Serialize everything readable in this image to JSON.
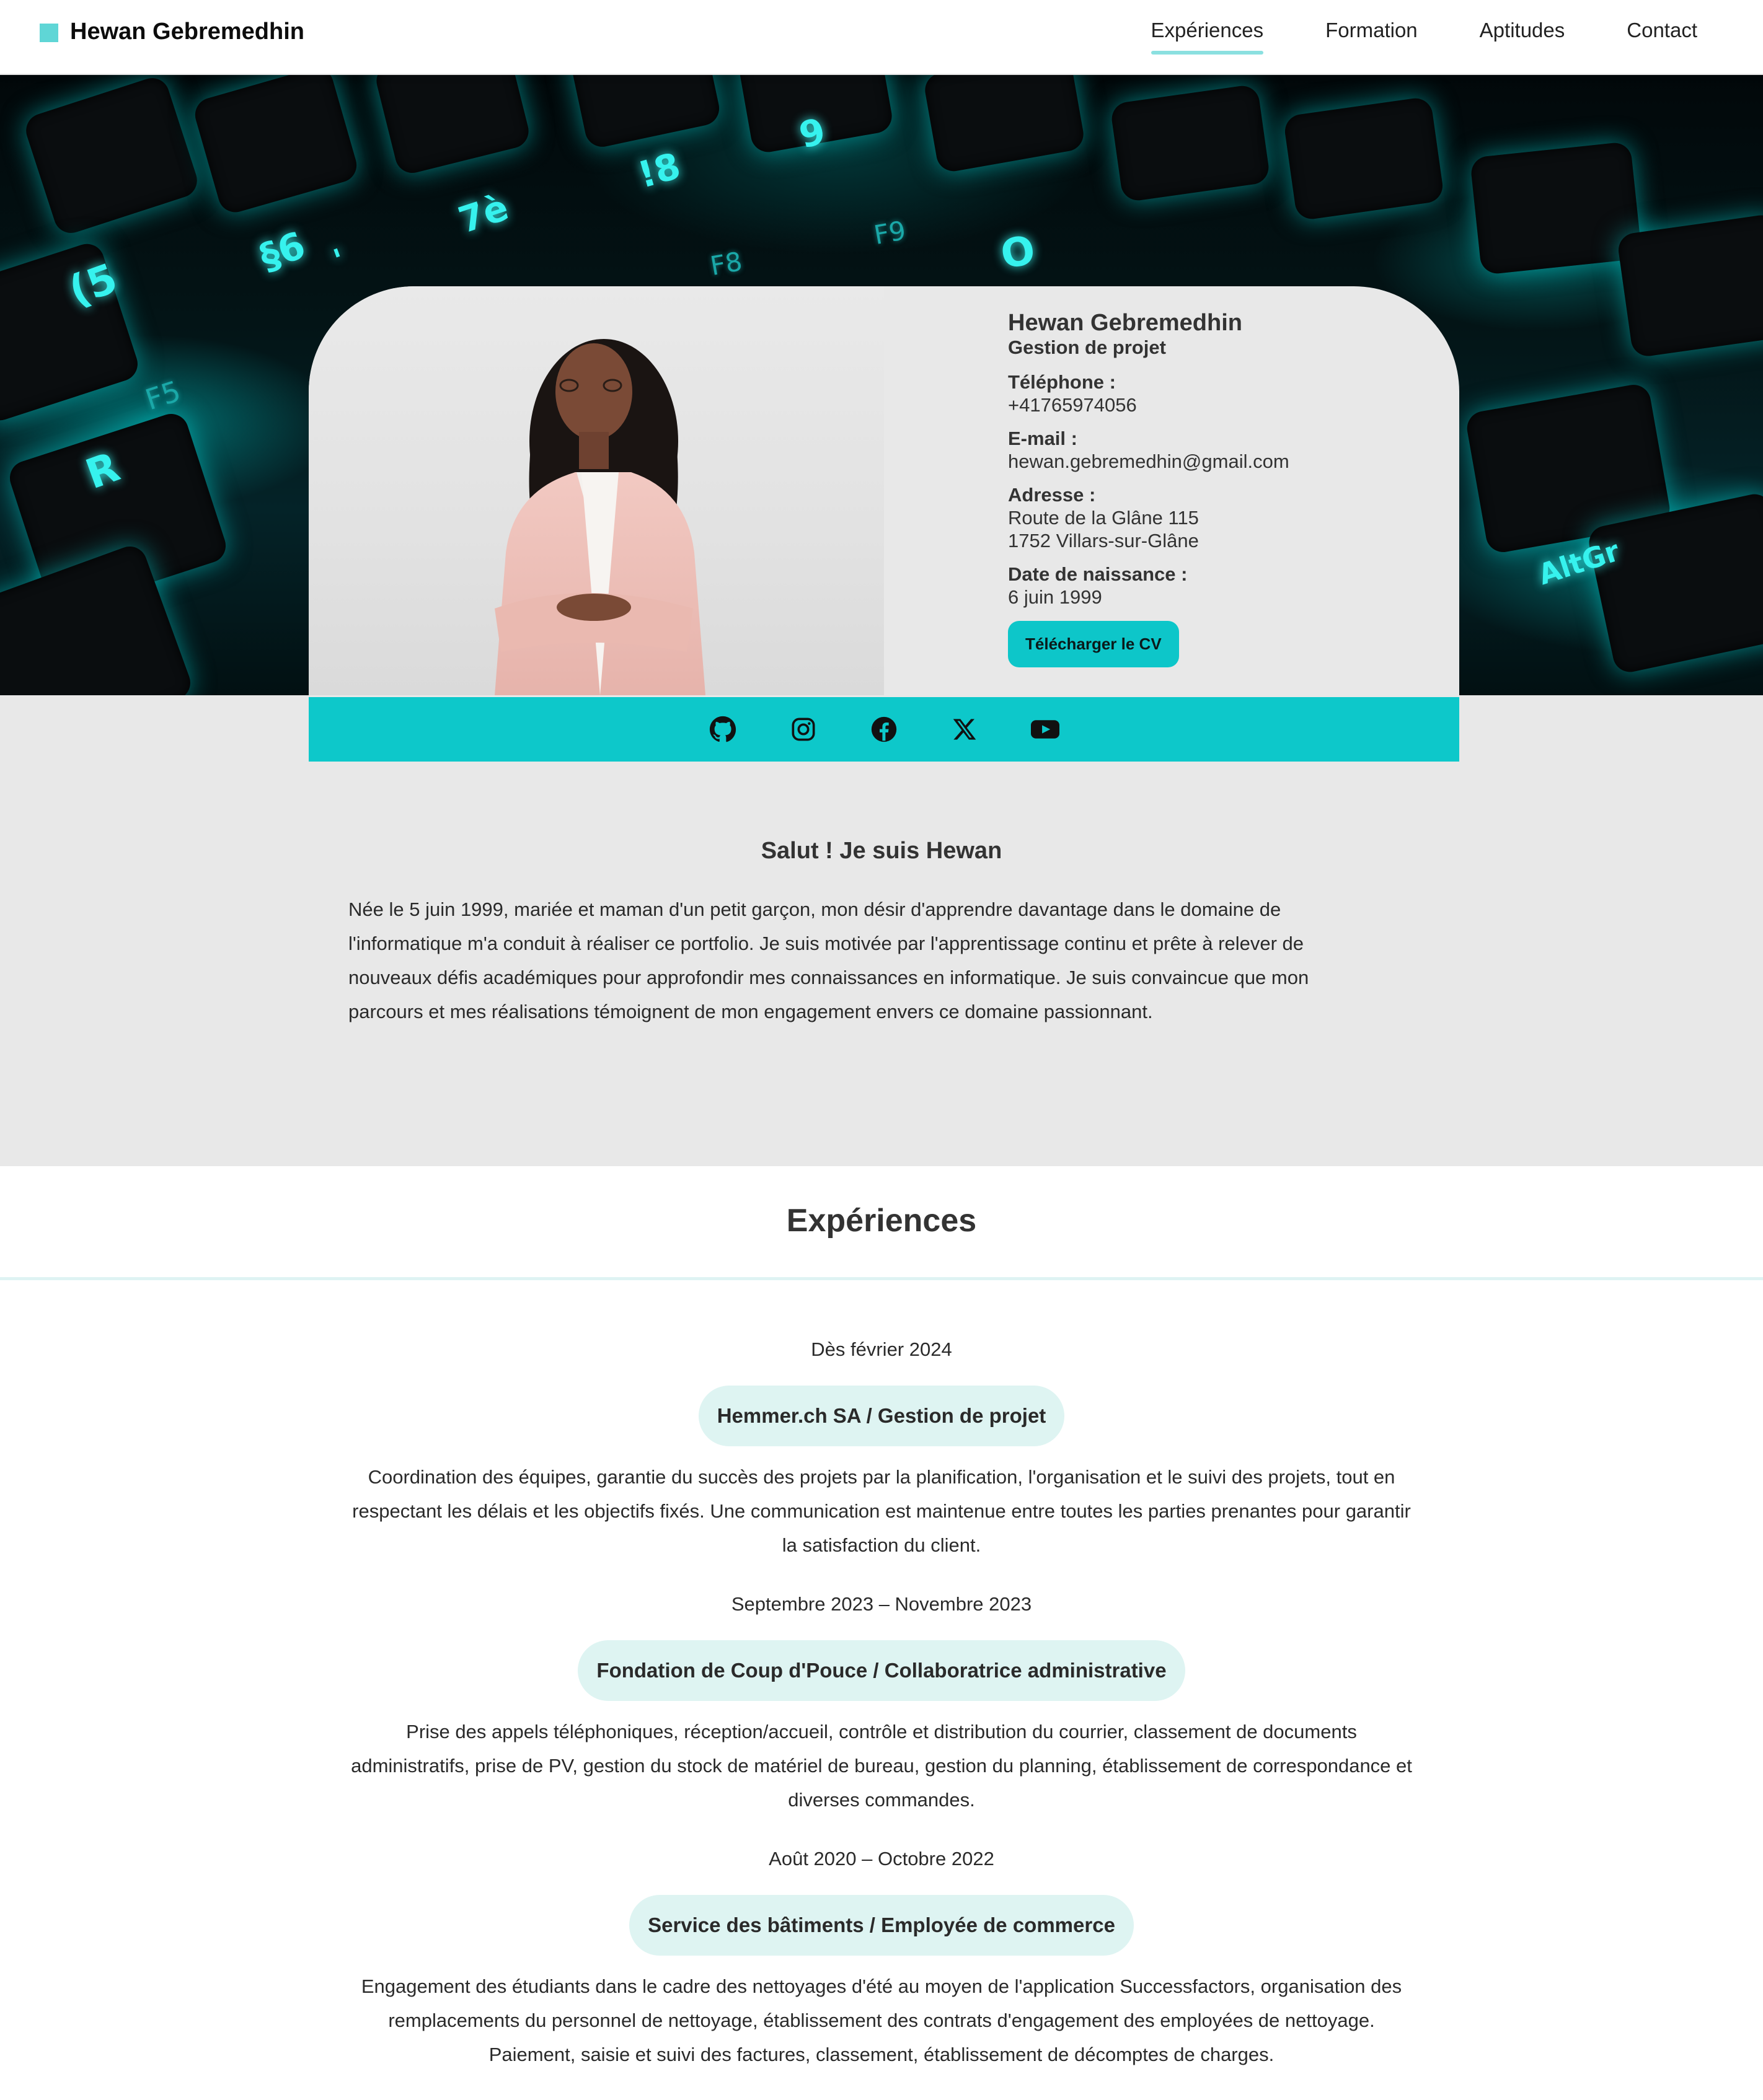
{
  "header": {
    "brand": "Hewan Gebremedhin",
    "nav": [
      "Expériences",
      "Formation",
      "Aptitudes",
      "Contact"
    ],
    "active_nav": "Expériences"
  },
  "hero": {
    "keys": [
      "(5",
      "§6",
      "'",
      "7è",
      "!8",
      "9",
      "F8",
      "F9",
      "O",
      "F5",
      "R",
      "AltGr"
    ]
  },
  "profile": {
    "name": "Hewan Gebremedhin",
    "role": "Gestion de projet",
    "phone_label": "Téléphone :",
    "phone": "+41765974056",
    "email_label": "E-mail :",
    "email": "hewan.gebremedhin@gmail.com",
    "address_label": "Adresse :",
    "address_line1": "Route de la Glâne 115",
    "address_line2": "1752 Villars-sur-Glâne",
    "birth_label": "Date de naissance :",
    "birth": "6 juin 1999",
    "cv_button": "Télécharger le CV"
  },
  "social": [
    "github-icon",
    "instagram-icon",
    "facebook-icon",
    "x-icon",
    "youtube-icon"
  ],
  "about": {
    "title": "Salut ! Je suis Hewan",
    "text": "Née le 5 juin 1999, mariée et maman d'un petit garçon, mon désir d'apprendre davantage dans le domaine de l'informatique m'a conduit à réaliser ce portfolio. Je suis motivée par l'apprentissage continu et prête à relever de nouveaux défis académiques pour approfondir mes connaissances en informatique. Je suis convaincue que mon parcours et mes réalisations témoignent de mon engagement envers ce domaine passionnant."
  },
  "experiences": {
    "title": "Expériences",
    "items": [
      {
        "date": "Dès février 2024",
        "title": "Hemmer.ch SA / Gestion de projet",
        "desc": "Coordination des équipes, garantie du succès des projets par la planification, l'organisation et le suivi des projets, tout en respectant les délais et les objectifs fixés. Une communication est maintenue entre toutes les parties prenantes pour garantir la satisfaction du client."
      },
      {
        "date": "Septembre 2023 – Novembre 2023",
        "title": "Fondation de Coup d'Pouce / Collaboratrice administrative",
        "desc": "Prise des appels téléphoniques, réception/accueil, contrôle et distribution du courrier, classement de documents administratifs, prise de PV, gestion du stock de matériel de bureau, gestion du planning, établissement de correspondance et diverses commandes."
      },
      {
        "date": "Août 2020 – Octobre 2022",
        "title": "Service des bâtiments / Employée de commerce",
        "desc": "Engagement des étudiants dans le cadre des nettoyages d'été au moyen de l'application Successfactors, organisation des remplacements du personnel de nettoyage, établissement des contrats d'engagement des employées de nettoyage. Paiement, saisie et suivi des factures, classement, établissement de décomptes de charges."
      }
    ]
  },
  "colors": {
    "accent": "#0dc8ca",
    "pill": "#def4f2",
    "panel": "#e8e8e8"
  }
}
